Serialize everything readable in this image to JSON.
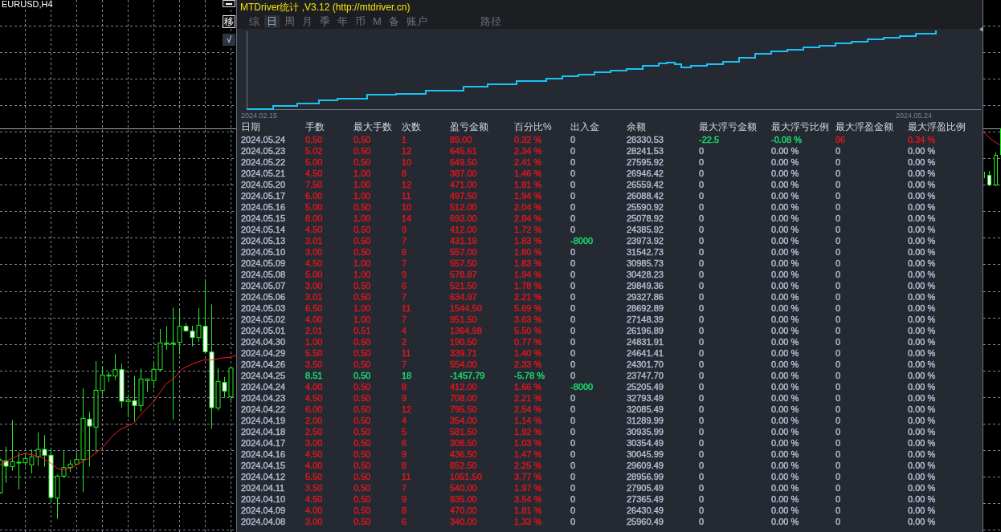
{
  "chart": {
    "symbol": "EURUSD,H4"
  },
  "chart_buttons": [
    {
      "kind": "minimize"
    },
    {
      "kind": "outlined",
      "label": "移"
    },
    {
      "kind": "filled",
      "label": "√"
    }
  ],
  "panel": {
    "title": "MTDriver统计 ,V3.12 (http://mtdriver.cn)",
    "tabs": [
      {
        "label": "综",
        "selected": false
      },
      {
        "label": "日",
        "selected": true
      },
      {
        "label": "周",
        "selected": false
      },
      {
        "label": "月",
        "selected": false
      },
      {
        "label": "季",
        "selected": false
      },
      {
        "label": "年",
        "selected": false
      },
      {
        "label": "币",
        "selected": false
      },
      {
        "label": "M",
        "selected": false
      },
      {
        "label": "备",
        "selected": false
      },
      {
        "label": "账户",
        "selected": false
      }
    ],
    "path_button": {
      "label": "路径"
    },
    "equity_chart": {
      "start_date": "2024.02.15",
      "end_date": "2024.05.24"
    },
    "table": {
      "columns": [
        "日期",
        "手数",
        "最大手数",
        "次数",
        "盈亏金额",
        "百分比%",
        "出入金",
        "余额",
        "最大浮亏金额",
        "最大浮亏比例",
        "最大浮盈金额",
        "最大浮盈比例"
      ],
      "rows": [
        {
          "date": "2024.05.24",
          "trade": {
            "values": [
              "0.50",
              "0.50",
              "1",
              "89.00",
              "0.32 %"
            ],
            "color": "#e0161e"
          },
          "deposit": {
            "text": "0"
          },
          "balance": "28330.53",
          "floating": [
            {
              "text": "-22.5",
              "color": "#18e070"
            },
            {
              "text": "-0.08 %",
              "color": "#18e070"
            },
            {
              "text": "96",
              "color": "#e0161e"
            },
            {
              "text": "0.34 %",
              "color": "#e0161e"
            }
          ]
        },
        {
          "date": "2024.05.23",
          "trade": {
            "values": [
              "5.02",
              "0.50",
              "12",
              "645.61",
              "2.34 %"
            ],
            "color": "#e0161e"
          },
          "deposit": {
            "text": "0"
          },
          "balance": "28241.53",
          "floating": [
            {
              "text": "0"
            },
            {
              "text": "0.00 %"
            },
            {
              "text": "0"
            },
            {
              "text": "0.00 %"
            }
          ]
        },
        {
          "date": "2024.05.22",
          "trade": {
            "values": [
              "5.00",
              "0.50",
              "10",
              "649.50",
              "2.41 %"
            ],
            "color": "#e0161e"
          },
          "deposit": {
            "text": "0"
          },
          "balance": "27595.92",
          "floating": [
            {
              "text": "0"
            },
            {
              "text": "0.00 %"
            },
            {
              "text": "0"
            },
            {
              "text": "0.00 %"
            }
          ]
        },
        {
          "date": "2024.05.21",
          "trade": {
            "values": [
              "4.50",
              "1.00",
              "8",
              "387.00",
              "1.46 %"
            ],
            "color": "#e0161e"
          },
          "deposit": {
            "text": "0"
          },
          "balance": "26946.42",
          "floating": [
            {
              "text": "0"
            },
            {
              "text": "0.00 %"
            },
            {
              "text": "0"
            },
            {
              "text": "0.00 %"
            }
          ]
        },
        {
          "date": "2024.05.20",
          "trade": {
            "values": [
              "7.50",
              "1.00",
              "12",
              "471.00",
              "1.81 %"
            ],
            "color": "#e0161e"
          },
          "deposit": {
            "text": "0"
          },
          "balance": "26559.42",
          "floating": [
            {
              "text": "0"
            },
            {
              "text": "0.00 %"
            },
            {
              "text": "0"
            },
            {
              "text": "0.00 %"
            }
          ]
        },
        {
          "date": "2024.05.17",
          "trade": {
            "values": [
              "6.00",
              "1.00",
              "11",
              "497.50",
              "1.94 %"
            ],
            "color": "#e0161e"
          },
          "deposit": {
            "text": "0"
          },
          "balance": "26088.42",
          "floating": [
            {
              "text": "0"
            },
            {
              "text": "0.00 %"
            },
            {
              "text": "0"
            },
            {
              "text": "0.00 %"
            }
          ]
        },
        {
          "date": "2024.05.16",
          "trade": {
            "values": [
              "5.00",
              "0.50",
              "10",
              "512.00",
              "2.04 %"
            ],
            "color": "#e0161e"
          },
          "deposit": {
            "text": "0"
          },
          "balance": "25590.92",
          "floating": [
            {
              "text": "0"
            },
            {
              "text": "0.00 %"
            },
            {
              "text": "0"
            },
            {
              "text": "0.00 %"
            }
          ]
        },
        {
          "date": "2024.05.15",
          "trade": {
            "values": [
              "8.00",
              "1.00",
              "14",
              "693.00",
              "2.84 %"
            ],
            "color": "#e0161e"
          },
          "deposit": {
            "text": "0"
          },
          "balance": "25078.92",
          "floating": [
            {
              "text": "0"
            },
            {
              "text": "0.00 %"
            },
            {
              "text": "0"
            },
            {
              "text": "0.00 %"
            }
          ]
        },
        {
          "date": "2024.05.14",
          "trade": {
            "values": [
              "4.50",
              "0.50",
              "9",
              "412.00",
              "1.72 %"
            ],
            "color": "#e0161e"
          },
          "deposit": {
            "text": "0"
          },
          "balance": "24385.92",
          "floating": [
            {
              "text": "0"
            },
            {
              "text": "0.00 %"
            },
            {
              "text": "0"
            },
            {
              "text": "0.00 %"
            }
          ]
        },
        {
          "date": "2024.05.13",
          "trade": {
            "values": [
              "3.01",
              "0.50",
              "7",
              "431.19",
              "1.83 %"
            ],
            "color": "#e0161e"
          },
          "deposit": {
            "text": "-8000",
            "color": "#18e070"
          },
          "balance": "23973.92",
          "floating": [
            {
              "text": "0"
            },
            {
              "text": "0.00 %"
            },
            {
              "text": "0"
            },
            {
              "text": "0.00 %"
            }
          ]
        },
        {
          "date": "2024.05.10",
          "trade": {
            "values": [
              "3.00",
              "0.50",
              "6",
              "557.00",
              "1.80 %"
            ],
            "color": "#e0161e"
          },
          "deposit": {
            "text": "0"
          },
          "balance": "31542.73",
          "floating": [
            {
              "text": "0"
            },
            {
              "text": "0.00 %"
            },
            {
              "text": "0"
            },
            {
              "text": "0.00 %"
            }
          ]
        },
        {
          "date": "2024.05.09",
          "trade": {
            "values": [
              "4.50",
              "1.00",
              "7",
              "557.50",
              "1.83 %"
            ],
            "color": "#e0161e"
          },
          "deposit": {
            "text": "0"
          },
          "balance": "30985.73",
          "floating": [
            {
              "text": "0"
            },
            {
              "text": "0.00 %"
            },
            {
              "text": "0"
            },
            {
              "text": "0.00 %"
            }
          ]
        },
        {
          "date": "2024.05.08",
          "trade": {
            "values": [
              "5.00",
              "1.00",
              "9",
              "578.87",
              "1.94 %"
            ],
            "color": "#e0161e"
          },
          "deposit": {
            "text": "0"
          },
          "balance": "30428.23",
          "floating": [
            {
              "text": "0"
            },
            {
              "text": "0.00 %"
            },
            {
              "text": "0"
            },
            {
              "text": "0.00 %"
            }
          ]
        },
        {
          "date": "2024.05.07",
          "trade": {
            "values": [
              "3.00",
              "0.50",
              "6",
              "521.50",
              "1.78 %"
            ],
            "color": "#e0161e"
          },
          "deposit": {
            "text": "0"
          },
          "balance": "29849.36",
          "floating": [
            {
              "text": "0"
            },
            {
              "text": "0.00 %"
            },
            {
              "text": "0"
            },
            {
              "text": "0.00 %"
            }
          ]
        },
        {
          "date": "2024.05.06",
          "trade": {
            "values": [
              "3.01",
              "0.50",
              "7",
              "634.97",
              "2.21 %"
            ],
            "color": "#e0161e"
          },
          "deposit": {
            "text": "0"
          },
          "balance": "29327.86",
          "floating": [
            {
              "text": "0"
            },
            {
              "text": "0.00 %"
            },
            {
              "text": "0"
            },
            {
              "text": "0.00 %"
            }
          ]
        },
        {
          "date": "2024.05.03",
          "trade": {
            "values": [
              "6.50",
              "1.00",
              "11",
              "1544.50",
              "5.69 %"
            ],
            "color": "#e0161e"
          },
          "deposit": {
            "text": "0"
          },
          "balance": "28692.89",
          "floating": [
            {
              "text": "0"
            },
            {
              "text": "0.00 %"
            },
            {
              "text": "0"
            },
            {
              "text": "0.00 %"
            }
          ]
        },
        {
          "date": "2024.05.02",
          "trade": {
            "values": [
              "4.00",
              "1.00",
              "7",
              "951.50",
              "3.63 %"
            ],
            "color": "#e0161e"
          },
          "deposit": {
            "text": "0"
          },
          "balance": "27148.39",
          "floating": [
            {
              "text": "0"
            },
            {
              "text": "0.00 %"
            },
            {
              "text": "0"
            },
            {
              "text": "0.00 %"
            }
          ]
        },
        {
          "date": "2024.05.01",
          "trade": {
            "values": [
              "2.01",
              "0.51",
              "4",
              "1364.98",
              "5.50 %"
            ],
            "color": "#e0161e"
          },
          "deposit": {
            "text": "0"
          },
          "balance": "26196.89",
          "floating": [
            {
              "text": "0"
            },
            {
              "text": "0.00 %"
            },
            {
              "text": "0"
            },
            {
              "text": "0.00 %"
            }
          ]
        },
        {
          "date": "2024.04.30",
          "trade": {
            "values": [
              "1.00",
              "0.50",
              "2",
              "190.50",
              "0.77 %"
            ],
            "color": "#e0161e"
          },
          "deposit": {
            "text": "0"
          },
          "balance": "24831.91",
          "floating": [
            {
              "text": "0"
            },
            {
              "text": "0.00 %"
            },
            {
              "text": "0"
            },
            {
              "text": "0.00 %"
            }
          ]
        },
        {
          "date": "2024.04.29",
          "trade": {
            "values": [
              "5.50",
              "0.50",
              "11",
              "339.71",
              "1.40 %"
            ],
            "color": "#e0161e"
          },
          "deposit": {
            "text": "0"
          },
          "balance": "24641.41",
          "floating": [
            {
              "text": "0"
            },
            {
              "text": "0.00 %"
            },
            {
              "text": "0"
            },
            {
              "text": "0.00 %"
            }
          ]
        },
        {
          "date": "2024.04.26",
          "trade": {
            "values": [
              "3.50",
              "0.50",
              "7",
              "554.00",
              "2.33 %"
            ],
            "color": "#e0161e"
          },
          "deposit": {
            "text": "0"
          },
          "balance": "24301.70",
          "floating": [
            {
              "text": "0"
            },
            {
              "text": "0.00 %"
            },
            {
              "text": "0"
            },
            {
              "text": "0.00 %"
            }
          ]
        },
        {
          "date": "2024.04.25",
          "trade": {
            "values": [
              "8.51",
              "0.50",
              "18",
              "-1457.79",
              "-5.78 %"
            ],
            "color": "#18e070"
          },
          "deposit": {
            "text": "0"
          },
          "balance": "23747.70",
          "floating": [
            {
              "text": "0"
            },
            {
              "text": "0.00 %"
            },
            {
              "text": "0"
            },
            {
              "text": "0.00 %"
            }
          ]
        },
        {
          "date": "2024.04.24",
          "trade": {
            "values": [
              "4.00",
              "0.50",
              "8",
              "412.00",
              "1.66 %"
            ],
            "color": "#e0161e"
          },
          "deposit": {
            "text": "-8000",
            "color": "#18e070"
          },
          "balance": "25205.49",
          "floating": [
            {
              "text": "0"
            },
            {
              "text": "0.00 %"
            },
            {
              "text": "0"
            },
            {
              "text": "0.00 %"
            }
          ]
        },
        {
          "date": "2024.04.23",
          "trade": {
            "values": [
              "4.50",
              "0.50",
              "9",
              "708.00",
              "2.21 %"
            ],
            "color": "#e0161e"
          },
          "deposit": {
            "text": "0"
          },
          "balance": "32793.49",
          "floating": [
            {
              "text": "0"
            },
            {
              "text": "0.00 %"
            },
            {
              "text": "0"
            },
            {
              "text": "0.00 %"
            }
          ]
        },
        {
          "date": "2024.04.22",
          "trade": {
            "values": [
              "6.00",
              "0.50",
              "12",
              "795.50",
              "2.54 %"
            ],
            "color": "#e0161e"
          },
          "deposit": {
            "text": "0"
          },
          "balance": "32085.49",
          "floating": [
            {
              "text": "0"
            },
            {
              "text": "0.00 %"
            },
            {
              "text": "0"
            },
            {
              "text": "0.00 %"
            }
          ]
        },
        {
          "date": "2024.04.19",
          "trade": {
            "values": [
              "2.00",
              "0.50",
              "4",
              "354.00",
              "1.14 %"
            ],
            "color": "#e0161e"
          },
          "deposit": {
            "text": "0"
          },
          "balance": "31289.99",
          "floating": [
            {
              "text": "0"
            },
            {
              "text": "0.00 %"
            },
            {
              "text": "0"
            },
            {
              "text": "0.00 %"
            }
          ]
        },
        {
          "date": "2024.04.18",
          "trade": {
            "values": [
              "2.50",
              "0.50",
              "5",
              "581.50",
              "1.92 %"
            ],
            "color": "#e0161e"
          },
          "deposit": {
            "text": "0"
          },
          "balance": "30935.99",
          "floating": [
            {
              "text": "0"
            },
            {
              "text": "0.00 %"
            },
            {
              "text": "0"
            },
            {
              "text": "0.00 %"
            }
          ]
        },
        {
          "date": "2024.04.17",
          "trade": {
            "values": [
              "3.00",
              "0.50",
              "6",
              "308.50",
              "1.03 %"
            ],
            "color": "#e0161e"
          },
          "deposit": {
            "text": "0"
          },
          "balance": "30354.49",
          "floating": [
            {
              "text": "0"
            },
            {
              "text": "0.00 %"
            },
            {
              "text": "0"
            },
            {
              "text": "0.00 %"
            }
          ]
        },
        {
          "date": "2024.04.16",
          "trade": {
            "values": [
              "4.50",
              "0.50",
              "9",
              "436.50",
              "1.47 %"
            ],
            "color": "#e0161e"
          },
          "deposit": {
            "text": "0"
          },
          "balance": "30045.99",
          "floating": [
            {
              "text": "0"
            },
            {
              "text": "0.00 %"
            },
            {
              "text": "0"
            },
            {
              "text": "0.00 %"
            }
          ]
        },
        {
          "date": "2024.04.15",
          "trade": {
            "values": [
              "4.00",
              "0.50",
              "8",
              "652.50",
              "2.25 %"
            ],
            "color": "#e0161e"
          },
          "deposit": {
            "text": "0"
          },
          "balance": "29609.49",
          "floating": [
            {
              "text": "0"
            },
            {
              "text": "0.00 %"
            },
            {
              "text": "0"
            },
            {
              "text": "0.00 %"
            }
          ]
        },
        {
          "date": "2024.04.12",
          "trade": {
            "values": [
              "5.50",
              "0.50",
              "11",
              "1051.50",
              "3.77 %"
            ],
            "color": "#e0161e"
          },
          "deposit": {
            "text": "0"
          },
          "balance": "28956.99",
          "floating": [
            {
              "text": "0"
            },
            {
              "text": "0.00 %"
            },
            {
              "text": "0"
            },
            {
              "text": "0.00 %"
            }
          ]
        },
        {
          "date": "2024.04.11",
          "trade": {
            "values": [
              "3.50",
              "0.50",
              "7",
              "540.00",
              "1.97 %"
            ],
            "color": "#e0161e"
          },
          "deposit": {
            "text": "0"
          },
          "balance": "27905.49",
          "floating": [
            {
              "text": "0"
            },
            {
              "text": "0.00 %"
            },
            {
              "text": "0"
            },
            {
              "text": "0.00 %"
            }
          ]
        },
        {
          "date": "2024.04.10",
          "trade": {
            "values": [
              "4.50",
              "0.50",
              "9",
              "935.00",
              "3.54 %"
            ],
            "color": "#e0161e"
          },
          "deposit": {
            "text": "0"
          },
          "balance": "27365.49",
          "floating": [
            {
              "text": "0"
            },
            {
              "text": "0.00 %"
            },
            {
              "text": "0"
            },
            {
              "text": "0.00 %"
            }
          ]
        },
        {
          "date": "2024.04.09",
          "trade": {
            "values": [
              "4.00",
              "0.50",
              "8",
              "470.00",
              "1.81 %"
            ],
            "color": "#e0161e"
          },
          "deposit": {
            "text": "0"
          },
          "balance": "26430.49",
          "floating": [
            {
              "text": "0"
            },
            {
              "text": "0.00 %"
            },
            {
              "text": "0"
            },
            {
              "text": "0.00 %"
            }
          ]
        },
        {
          "date": "2024.04.08",
          "trade": {
            "values": [
              "3.00",
              "0.50",
              "6",
              "340.00",
              "1.33 %"
            ],
            "color": "#e0161e"
          },
          "deposit": {
            "text": "0"
          },
          "balance": "25960.49",
          "floating": [
            {
              "text": "0"
            },
            {
              "text": "0.00 %"
            },
            {
              "text": "0"
            },
            {
              "text": "0.00 %"
            }
          ]
        }
      ]
    }
  }
}
